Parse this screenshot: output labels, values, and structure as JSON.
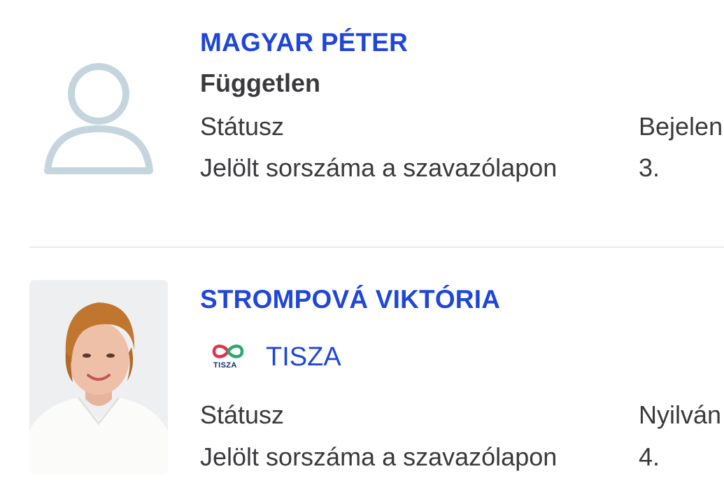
{
  "candidates": [
    {
      "name": "MAGYAR PÉTER",
      "party": "Független",
      "status_label": "Státusz",
      "status_value": "Bejelen",
      "number_label": "Jelölt sorszáma a szavazólapon",
      "number_value": "3."
    },
    {
      "name": "STROMPOVÁ VIKTÓRIA",
      "party": "TISZA",
      "party_logo_text": "TISZA",
      "status_label": "Státusz",
      "status_value": "Nyilván",
      "number_label": "Jelölt sorszáma a szavazólapon",
      "number_value": "4."
    }
  ],
  "icons": {
    "placeholder_avatar": "user-silhouette-icon",
    "party_logo": "infinity-logo-icon"
  },
  "colors": {
    "name_link": "#1f46d8",
    "text": "#3a3a3d",
    "placeholder": "#c5d5de",
    "divider": "#e6e8ec",
    "logo_red": "#e3324a",
    "logo_green": "#29a96a",
    "logo_text": "#1a2e6e"
  }
}
